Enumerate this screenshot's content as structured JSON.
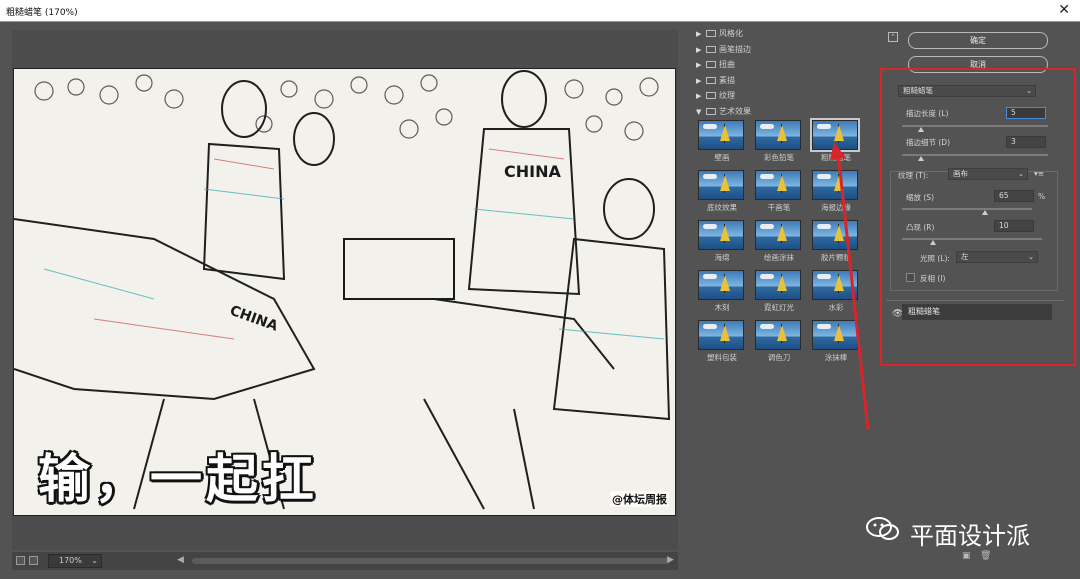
{
  "window": {
    "title": "粗糙蜡笔 (170%)",
    "close_glyph": "✕"
  },
  "preview": {
    "caption": "输，一起扛",
    "watermark": "@体坛周报",
    "zoom": "170%",
    "jersey_text": "CHINA"
  },
  "gallery": {
    "folders": [
      {
        "label": "风格化",
        "expanded": false
      },
      {
        "label": "画笔描边",
        "expanded": false
      },
      {
        "label": "扭曲",
        "expanded": false
      },
      {
        "label": "素描",
        "expanded": false
      },
      {
        "label": "纹理",
        "expanded": false
      },
      {
        "label": "艺术效果",
        "expanded": true
      }
    ],
    "filters": [
      {
        "label": "壁画",
        "selected": false
      },
      {
        "label": "彩色铅笔",
        "selected": false
      },
      {
        "label": "粗糙蜡笔",
        "selected": true
      },
      {
        "label": "底纹效果",
        "selected": false
      },
      {
        "label": "干画笔",
        "selected": false
      },
      {
        "label": "海报边缘",
        "selected": false
      },
      {
        "label": "海绵",
        "selected": false
      },
      {
        "label": "绘画涂抹",
        "selected": false
      },
      {
        "label": "胶片颗粒",
        "selected": false
      },
      {
        "label": "木刻",
        "selected": false
      },
      {
        "label": "霓虹灯光",
        "selected": false
      },
      {
        "label": "水彩",
        "selected": false
      },
      {
        "label": "塑料包装",
        "selected": false
      },
      {
        "label": "调色刀",
        "selected": false
      },
      {
        "label": "涂抹棒",
        "selected": false
      }
    ]
  },
  "settings": {
    "ok_label": "确定",
    "cancel_label": "取消",
    "filter_select": "粗糙蜡笔",
    "stroke_length": {
      "label": "描边长度 (L)",
      "value": "5"
    },
    "stroke_detail": {
      "label": "描边细节 (D)",
      "value": "3"
    },
    "texture": {
      "label": "纹理 (T):",
      "value": "画布"
    },
    "scaling": {
      "label": "缩放 (S)",
      "value": "65",
      "unit": "%"
    },
    "relief": {
      "label": "凸现 (R)",
      "value": "10"
    },
    "light": {
      "label": "光照 (L):",
      "value": "左"
    },
    "invert": {
      "label": "反相 (I)",
      "checked": false
    },
    "layer_name": "粗糙蜡笔",
    "menu_glyph": "▾≡"
  },
  "watermark": {
    "text": "平面设计派"
  },
  "colors": {
    "highlight": "#d9252a",
    "panel": "#535353",
    "accent": "#4a8ad8"
  }
}
